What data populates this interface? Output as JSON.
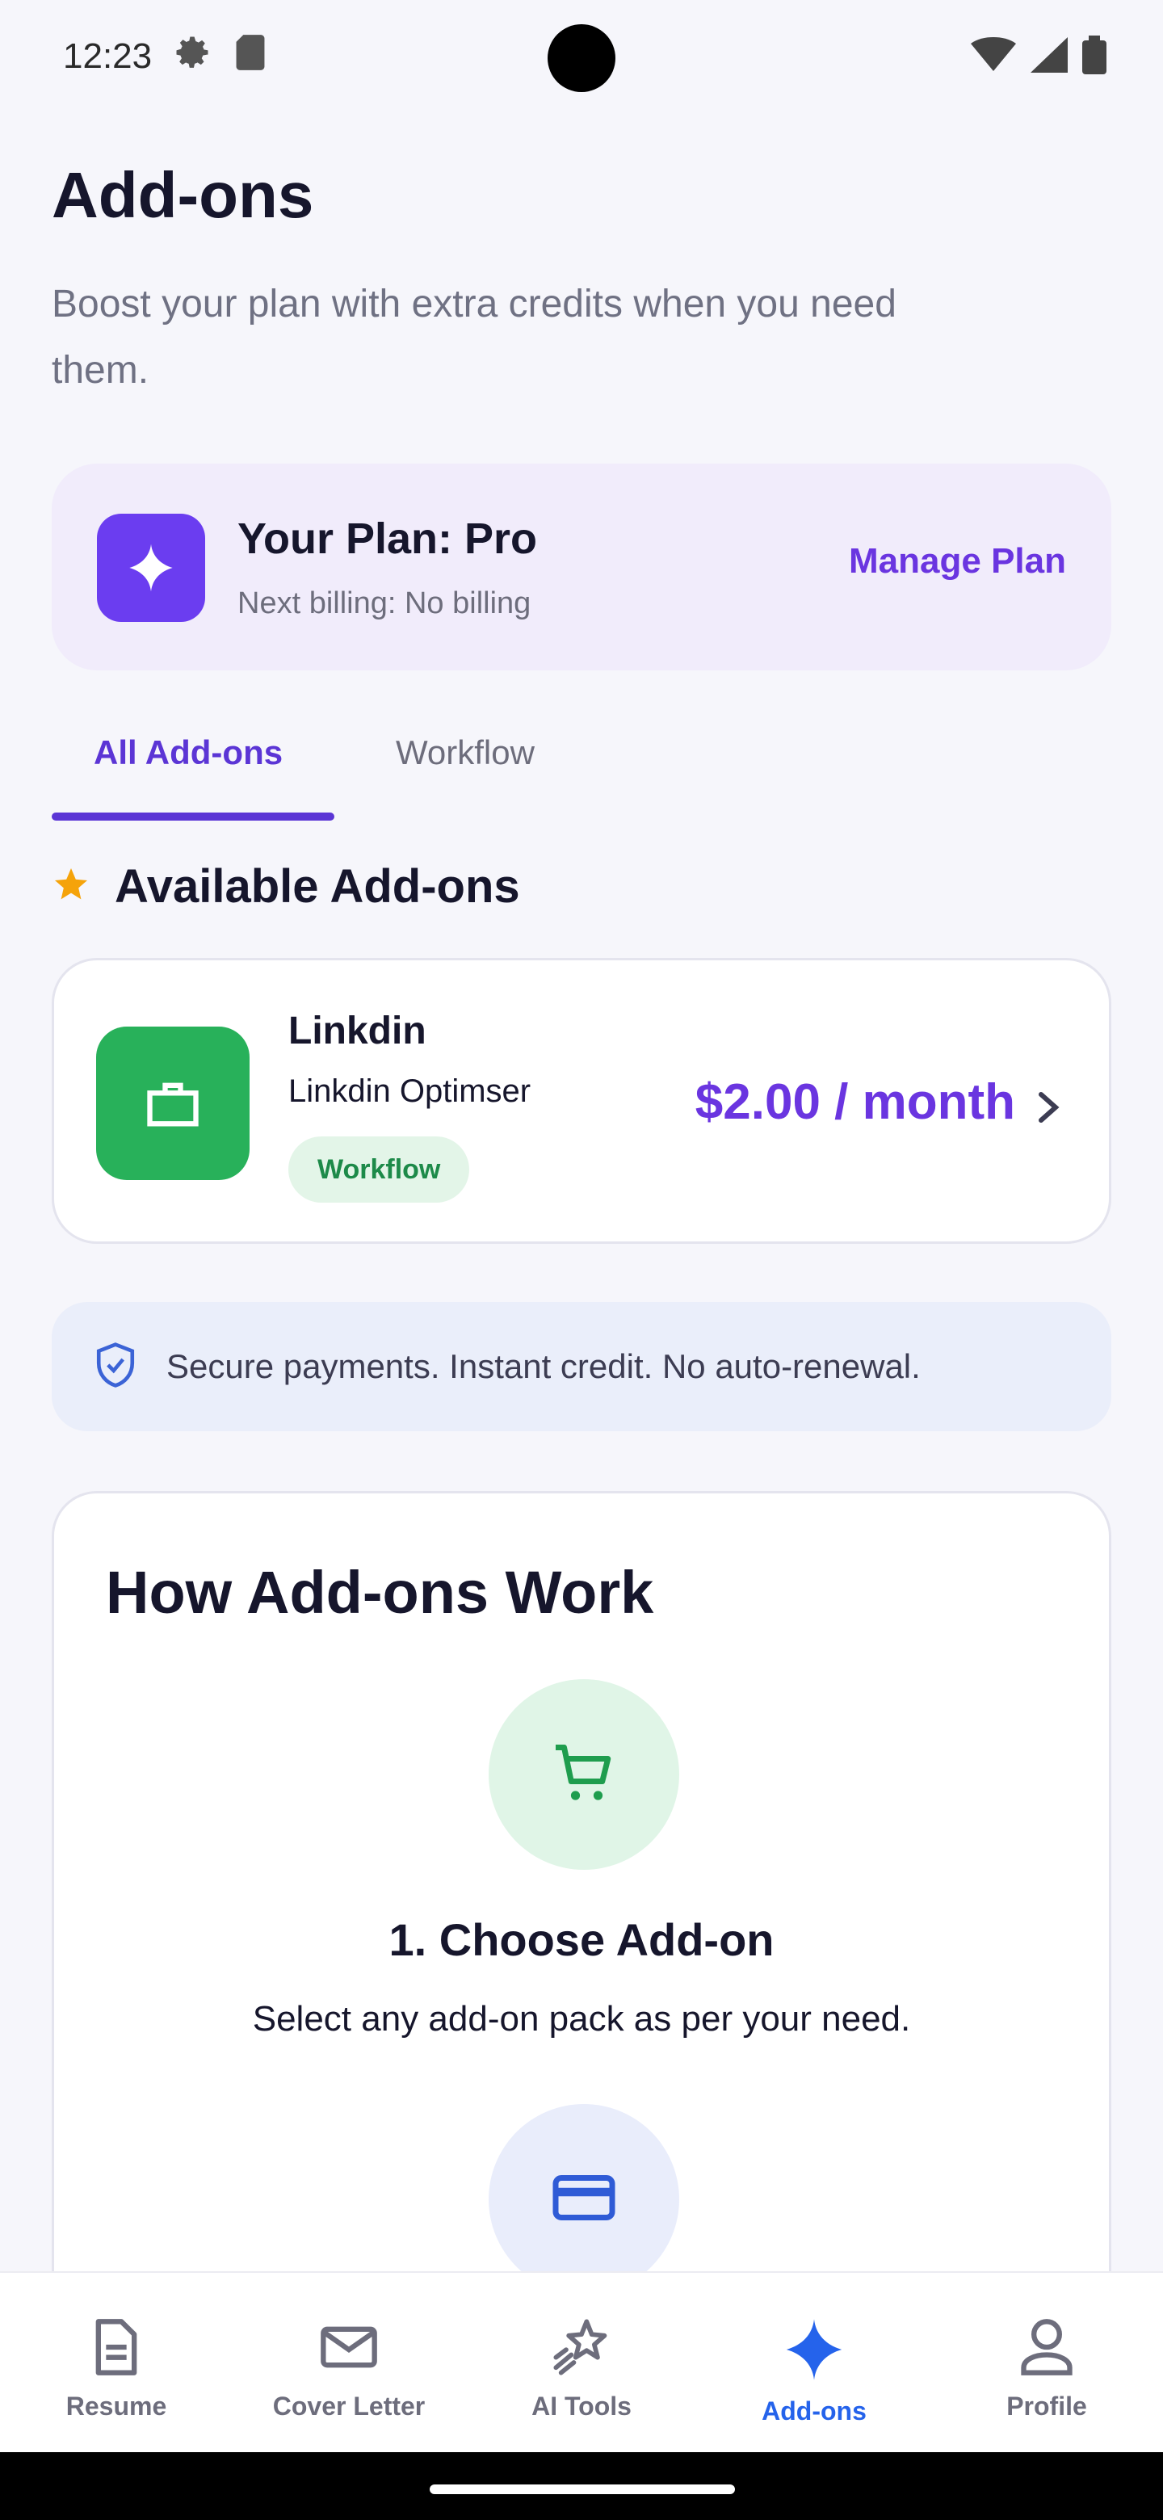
{
  "status_bar": {
    "time": "12:23"
  },
  "header": {
    "title": "Add-ons",
    "subtitle": "Boost your plan with extra credits when you need them."
  },
  "plan": {
    "title": "Your Plan: Pro",
    "billing": "Next billing: No billing",
    "manage_label": "Manage Plan"
  },
  "tabs": [
    {
      "label": "All Add-ons",
      "active": true
    },
    {
      "label": "Workflow",
      "active": false
    }
  ],
  "available": {
    "heading": "Available Add-ons",
    "items": [
      {
        "name": "Linkdin",
        "description": "Linkdin Optimser",
        "tag": "Workflow",
        "price": "$2.00 / month"
      }
    ]
  },
  "secure_banner": {
    "text": "Secure payments. Instant credit. No auto-renewal."
  },
  "how_it_works": {
    "title": "How Add-ons Work",
    "steps": [
      {
        "title": "1. Choose Add-on",
        "description": "Select any add-on pack as per your need.",
        "icon": "cart-icon"
      },
      {
        "icon": "credit-card-icon"
      }
    ]
  },
  "bottom_nav": [
    {
      "label": "Resume",
      "icon": "document-icon",
      "active": false
    },
    {
      "label": "Cover Letter",
      "icon": "mail-icon",
      "active": false
    },
    {
      "label": "AI Tools",
      "icon": "sparkle-stars-icon",
      "active": false
    },
    {
      "label": "Add-ons",
      "icon": "sparkle-icon",
      "active": true
    },
    {
      "label": "Profile",
      "icon": "person-icon",
      "active": false
    }
  ],
  "colors": {
    "accent": "#6a35e0",
    "nav_active": "#2563eb",
    "addon_green": "#28b15a",
    "star": "#f5a30a"
  }
}
